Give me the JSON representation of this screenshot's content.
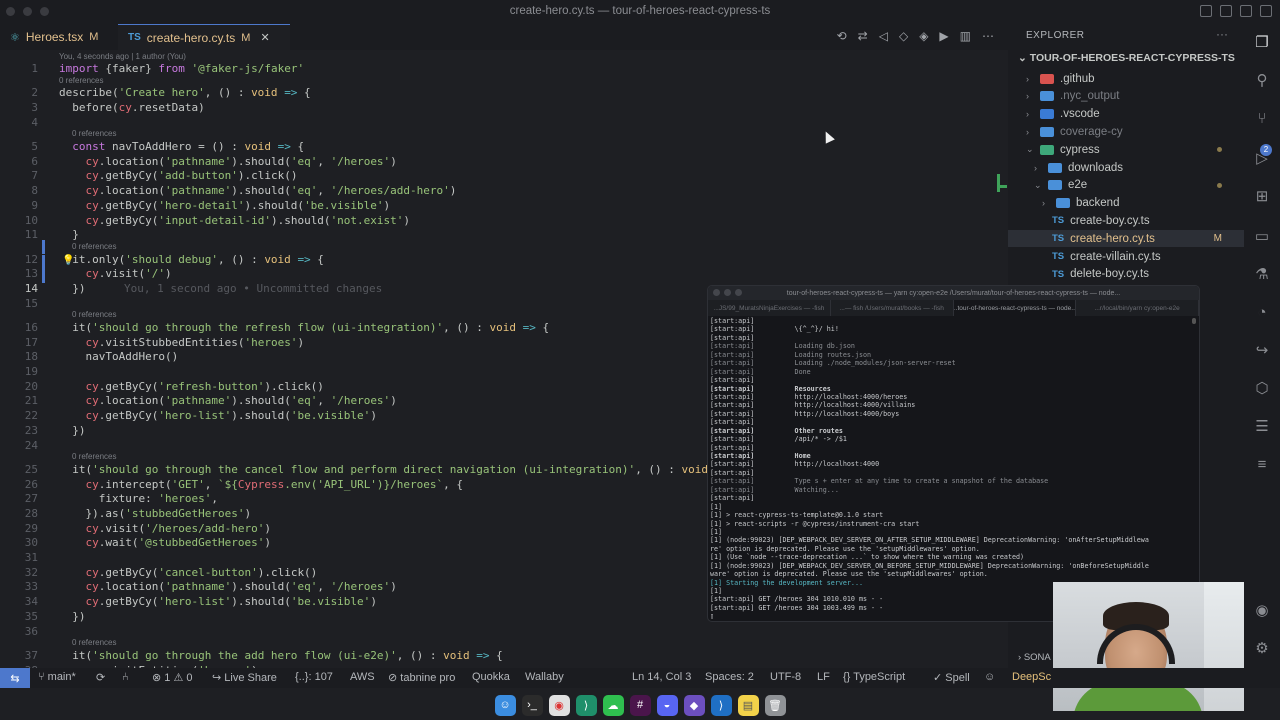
{
  "window": {
    "title": "create-hero.cy.ts — tour-of-heroes-react-cypress-ts"
  },
  "tabs": [
    {
      "name": "Heroes.tsx",
      "mark": "M"
    },
    {
      "name": "create-hero.cy.ts",
      "mark": "M",
      "close": "✕",
      "badge": "TS"
    }
  ],
  "editor": {
    "blame": "You, 4 seconds ago | 1 author (You)",
    "refs": "0 references",
    "ghost": "You, 1 second ago • Uncommitted changes",
    "lines": [
      {
        "n": "1",
        "t": "import {faker} from '@faker-js/faker'"
      },
      {
        "n": "2",
        "t": "describe('Create hero', () : void => {"
      },
      {
        "n": "3",
        "t": "  before(cy.resetData)"
      },
      {
        "n": "4",
        "t": ""
      },
      {
        "n": "5",
        "t": "  const navToAddHero = () : void => {"
      },
      {
        "n": "6",
        "t": "    cy.location('pathname').should('eq', '/heroes')"
      },
      {
        "n": "7",
        "t": "    cy.getByCy('add-button').click()"
      },
      {
        "n": "8",
        "t": "    cy.location('pathname').should('eq', '/heroes/add-hero')"
      },
      {
        "n": "9",
        "t": "    cy.getByCy('hero-detail').should('be.visible')"
      },
      {
        "n": "10",
        "t": "    cy.getByCy('input-detail-id').should('not.exist')"
      },
      {
        "n": "11",
        "t": "  }"
      },
      {
        "n": "12",
        "t": "  it.only('should debug', () : void => {"
      },
      {
        "n": "13",
        "t": "    cy.visit('/')"
      },
      {
        "n": "14",
        "t": "  })"
      },
      {
        "n": "15",
        "t": ""
      },
      {
        "n": "16",
        "t": "  it('should go through the refresh flow (ui-integration)', () : void => {"
      },
      {
        "n": "17",
        "t": "    cy.visitStubbedEntities('heroes')"
      },
      {
        "n": "18",
        "t": "    navToAddHero()"
      },
      {
        "n": "19",
        "t": ""
      },
      {
        "n": "20",
        "t": "    cy.getByCy('refresh-button').click()"
      },
      {
        "n": "21",
        "t": "    cy.location('pathname').should('eq', '/heroes')"
      },
      {
        "n": "22",
        "t": "    cy.getByCy('hero-list').should('be.visible')"
      },
      {
        "n": "23",
        "t": "  })"
      },
      {
        "n": "24",
        "t": ""
      },
      {
        "n": "25",
        "t": "  it('should go through the cancel flow and perform direct navigation (ui-integration)', () : void ="
      },
      {
        "n": "26",
        "t": "    cy.intercept('GET', `${Cypress.env('API_URL')}/heroes`, {"
      },
      {
        "n": "27",
        "t": "      fixture: 'heroes',"
      },
      {
        "n": "28",
        "t": "    }).as('stubbedGetHeroes')"
      },
      {
        "n": "29",
        "t": "    cy.visit('/heroes/add-hero')"
      },
      {
        "n": "30",
        "t": "    cy.wait('@stubbedGetHeroes')"
      },
      {
        "n": "31",
        "t": ""
      },
      {
        "n": "32",
        "t": "    cy.getByCy('cancel-button').click()"
      },
      {
        "n": "33",
        "t": "    cy.location('pathname').should('eq', '/heroes')"
      },
      {
        "n": "34",
        "t": "    cy.getByCy('hero-list').should('be.visible')"
      },
      {
        "n": "35",
        "t": "  })"
      },
      {
        "n": "36",
        "t": ""
      },
      {
        "n": "37",
        "t": "  it('should go through the add hero flow (ui-e2e)', () : void => {"
      },
      {
        "n": "38",
        "t": "    cy.visitEntities('heroes')"
      }
    ]
  },
  "explorer": {
    "header": "EXPLORER",
    "more": "···",
    "root": "TOUR-OF-HEROES-REACT-CYPRESS-TS",
    "items": [
      {
        "label": ".github",
        "kind": "folder",
        "color": "#d9534f",
        "indent": 0,
        "chev": "›"
      },
      {
        "label": ".nyc_output",
        "kind": "folder",
        "color": "#4a90d9",
        "indent": 0,
        "chev": "›",
        "dim": true
      },
      {
        "label": ".vscode",
        "kind": "folder",
        "color": "#3a7bd5",
        "indent": 0,
        "chev": "›"
      },
      {
        "label": "coverage-cy",
        "kind": "folder",
        "color": "#4a90d9",
        "indent": 0,
        "chev": "›",
        "dim": true
      },
      {
        "label": "cypress",
        "kind": "folder",
        "color": "#3ea87a",
        "indent": 0,
        "chev": "⌄",
        "dot": true
      },
      {
        "label": "downloads",
        "kind": "folder",
        "color": "#4a90d9",
        "indent": 1,
        "chev": "›"
      },
      {
        "label": "e2e",
        "kind": "folder",
        "color": "#4a90d9",
        "indent": 1,
        "chev": "⌄",
        "dot": true
      },
      {
        "label": "backend",
        "kind": "folder",
        "color": "#4a90d9",
        "indent": 2,
        "chev": "›"
      },
      {
        "label": "create-boy.cy.ts",
        "kind": "ts",
        "indent": 2
      },
      {
        "label": "create-hero.cy.ts",
        "kind": "ts",
        "indent": 2,
        "selected": true,
        "mark": "M"
      },
      {
        "label": "create-villain.cy.ts",
        "kind": "ts",
        "indent": 2
      },
      {
        "label": "delete-boy.cy.ts",
        "kind": "ts",
        "indent": 2
      }
    ],
    "outline": "SONA"
  },
  "terminal": {
    "title": "tour-of-heroes-react-cypress-ts — yarn cy:open-e2e /Users/murat/tour-of-heroes-react-cypress-ts — node...",
    "tabs": [
      "...JS/99_MuratsNinjaExercises — -fish",
      "...— fish /Users/murat/books — -fish",
      "...tour-of-heroes-react-cypress-ts — node...",
      "...r/local/bin/yarn cy:open-e2e"
    ],
    "lines": [
      "[start:api]",
      "[start:api]          \\{^_^}/ hi!",
      "[start:api]",
      "[start:api]          Loading db.json",
      "[start:api]          Loading routes.json",
      "[start:api]          Loading ./node_modules/json-server-reset",
      "[start:api]          Done",
      "[start:api]",
      "[start:api]          Resources",
      "[start:api]          http://localhost:4000/heroes",
      "[start:api]          http://localhost:4000/villains",
      "[start:api]          http://localhost:4000/boys",
      "[start:api]",
      "[start:api]          Other routes",
      "[start:api]          /api/* -> /$1",
      "[start:api]",
      "[start:api]          Home",
      "[start:api]          http://localhost:4000",
      "[start:api]",
      "[start:api]          Type s + enter at any time to create a snapshot of the database",
      "[start:api]          Watching...",
      "[start:api]",
      "[1]",
      "[1] > react-cypress-ts-template@0.1.0 start",
      "[1] > react-scripts -r @cypress/instrument-cra start",
      "[1]",
      "[1] (node:99023) [DEP_WEBPACK_DEV_SERVER_ON_AFTER_SETUP_MIDDLEWARE] DeprecationWarning: 'onAfterSetupMiddlewa",
      "re' option is deprecated. Please use the 'setupMiddlewares' option.",
      "[1] (Use `node --trace-deprecation ...` to show where the warning was created)",
      "[1] (node:99023) [DEP_WEBPACK_DEV_SERVER_ON_BEFORE_SETUP_MIDDLEWARE] DeprecationWarning: 'onBeforeSetupMiddle",
      "ware' option is deprecated. Please use the 'setupMiddlewares' option.",
      "[1] Starting the development server...",
      "[1]",
      "[start:api] GET /heroes 304 1010.010 ms - -",
      "[start:api] GET /heroes 304 1003.499 ms - -",
      "▯"
    ]
  },
  "statusbar": {
    "remote": "⇆",
    "branch": "main*",
    "errors": "⊗ 1 ⚠ 0",
    "liveshare": "Live Share",
    "braces": "{..}: 107",
    "aws": "AWS",
    "tabnine": "⊘ tabnine pro",
    "quokka": "Quokka",
    "wallaby": "Wallaby",
    "position": "Ln 14, Col 3",
    "spaces": "Spaces: 2",
    "encoding": "UTF-8",
    "eol": "LF",
    "language": "{} TypeScript",
    "spell": "✓ Spell",
    "deep": "DeepSc"
  },
  "activity_icons": [
    "files-icon",
    "search-icon",
    "source-control-icon",
    "run-debug-icon",
    "extensions-icon",
    "remote-explorer-icon",
    "testing-icon",
    "timeline-icon",
    "live-share-icon",
    "docker-icon",
    "list-icon",
    "notes-icon",
    "account-icon",
    "settings-gear-icon"
  ],
  "scm_badge": "2",
  "dock_apps": [
    "Finder",
    "Terminal",
    "Chrome",
    "VS Code Insiders",
    "Cypress",
    "Slack",
    "Discord",
    "Obsidian",
    "VS Code",
    "Notes",
    "Trash"
  ]
}
